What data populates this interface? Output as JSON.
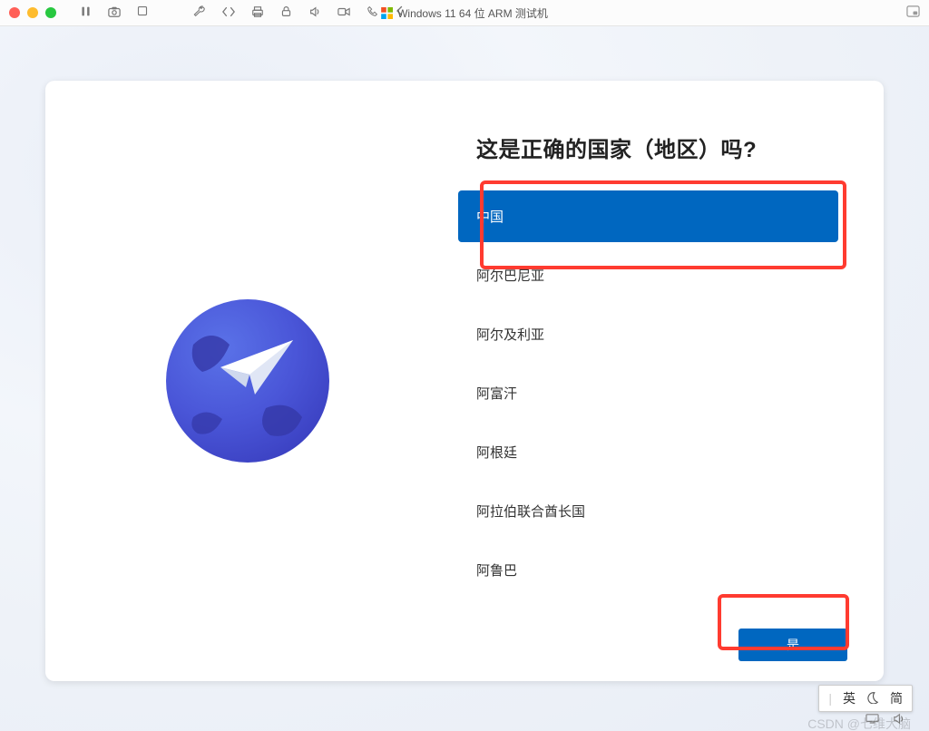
{
  "titlebar": {
    "window_title": "Windows 11 64 位 ARM 测试机",
    "icons": {
      "pause": "pause-icon",
      "snapshot": "camera-icon",
      "stop": "stop-icon",
      "wrench": "wrench-icon",
      "code": "code-icon",
      "printer": "printer-icon",
      "lock": "lock-icon",
      "sound": "sound-icon",
      "video": "video-icon",
      "phone": "phone-icon",
      "back": "back-icon",
      "window": "window-icon"
    }
  },
  "oobe": {
    "heading": "这是正确的国家（地区）吗?",
    "countries": [
      {
        "name": "中国",
        "selected": true
      },
      {
        "name": "阿尔巴尼亚",
        "selected": false
      },
      {
        "name": "阿尔及利亚",
        "selected": false
      },
      {
        "name": "阿富汗",
        "selected": false
      },
      {
        "name": "阿根廷",
        "selected": false
      },
      {
        "name": "阿拉伯联合酋长国",
        "selected": false
      },
      {
        "name": "阿鲁巴",
        "selected": false
      }
    ],
    "confirm_label": "是"
  },
  "ime": {
    "mode1": "英",
    "mode2": "简"
  },
  "watermark": "CSDN @七维大脑",
  "colors": {
    "accent": "#0067c0",
    "highlight": "#ff3b30"
  }
}
